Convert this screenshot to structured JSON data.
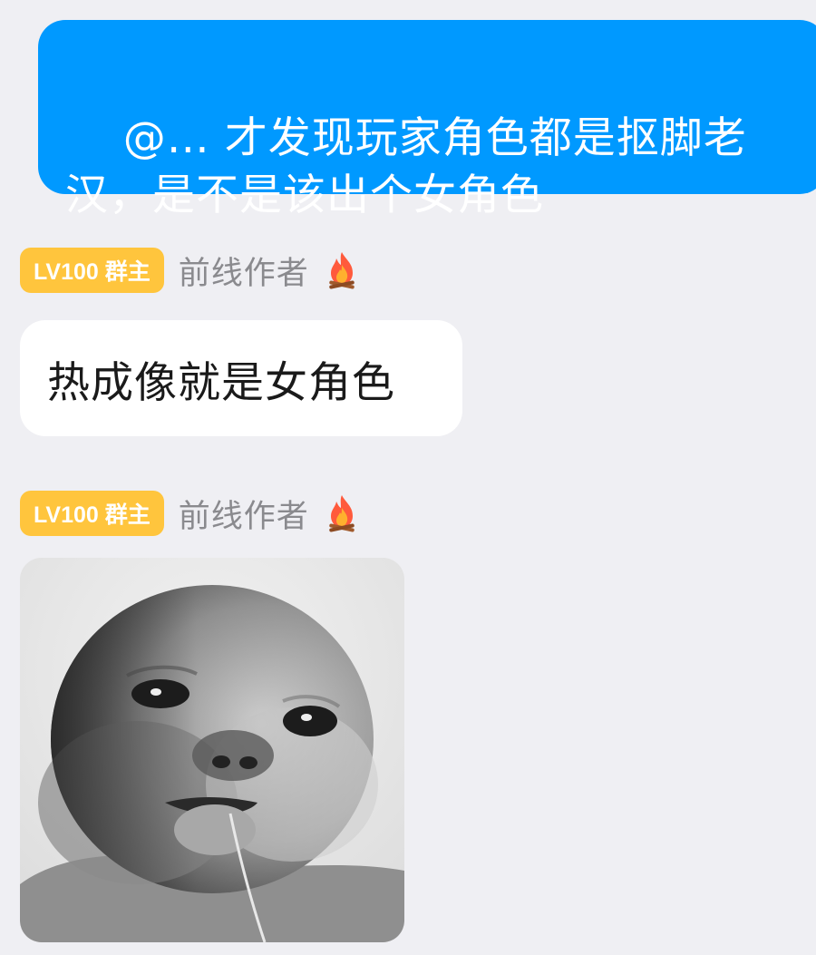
{
  "messages": {
    "outgoing": {
      "text": "@… 才发现玩家角色都是抠脚老汉，是不是该出个女角色",
      "bubble_color": "#0099ff"
    },
    "incoming_1": {
      "sender": {
        "badge": "LV100 群主",
        "name": "前线作者",
        "icon": "fire-icon"
      },
      "text": "热成像就是女角色"
    },
    "incoming_2": {
      "sender": {
        "badge": "LV100 群主",
        "name": "前线作者",
        "icon": "fire-icon"
      },
      "image": {
        "description_icon": "baby-meme-image"
      }
    }
  },
  "colors": {
    "background": "#efeff3",
    "badge": "#ffc53d",
    "sender_name": "#8a8a8e"
  }
}
